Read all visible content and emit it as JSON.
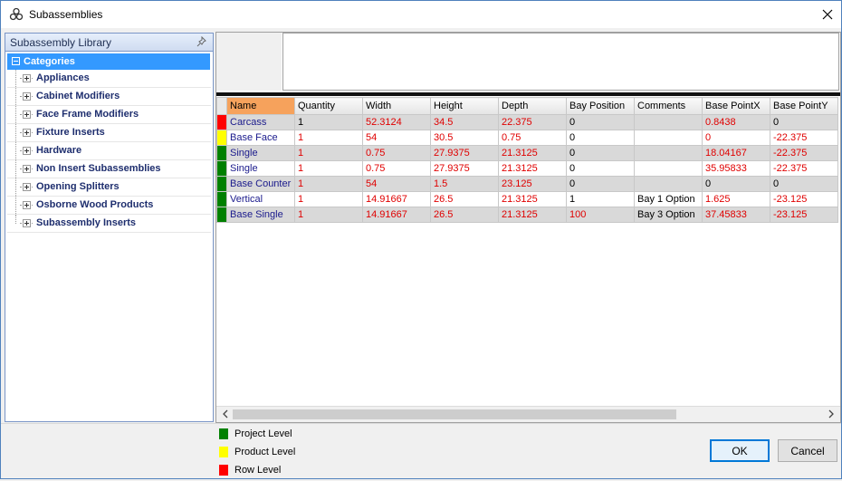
{
  "window": {
    "title": "Subassemblies"
  },
  "library": {
    "title": "Subassembly Library",
    "root": "Categories",
    "items": [
      "Appliances",
      "Cabinet Modifiers",
      "Face Frame Modifiers",
      "Fixture Inserts",
      "Hardware",
      "Non Insert Subassemblies",
      "Opening Splitters",
      "Osborne Wood Products",
      "Subassembly Inserts"
    ]
  },
  "grid": {
    "columns": [
      "Name",
      "Quantity",
      "Width",
      "Height",
      "Depth",
      "Bay Position",
      "Comments",
      "Base PointX",
      "Base PointY"
    ],
    "rows": [
      {
        "level": "row",
        "cells": [
          "Carcass",
          "1",
          "52.3124",
          "34.5",
          "22.375",
          "0",
          "",
          "0.8438",
          "0"
        ]
      },
      {
        "level": "product",
        "cells": [
          "Base Face",
          "1",
          "54",
          "30.5",
          "0.75",
          "0",
          "",
          "0",
          "-22.375"
        ]
      },
      {
        "level": "project",
        "cells": [
          "Single",
          "1",
          "0.75",
          "27.9375",
          "21.3125",
          "0",
          "",
          "18.04167",
          "-22.375"
        ]
      },
      {
        "level": "project",
        "cells": [
          "Single",
          "1",
          "0.75",
          "27.9375",
          "21.3125",
          "0",
          "",
          "35.95833",
          "-22.375"
        ]
      },
      {
        "level": "project",
        "cells": [
          "Base Counter",
          "1",
          "54",
          "1.5",
          "23.125",
          "0",
          "",
          "0",
          "0"
        ]
      },
      {
        "level": "project",
        "cells": [
          "Vertical",
          "1",
          "14.91667",
          "26.5",
          "21.3125",
          "1",
          "Bay 1 Option",
          "1.625",
          "-23.125"
        ]
      },
      {
        "level": "project",
        "cells": [
          "Base Single",
          "1",
          "14.91667",
          "26.5",
          "21.3125",
          "100",
          "Bay 3 Option",
          "37.45833",
          "-23.125"
        ]
      }
    ],
    "red_columns": [
      [
        false,
        false,
        true,
        true,
        true,
        false,
        false,
        true,
        false
      ],
      [
        false,
        true,
        true,
        true,
        true,
        false,
        false,
        true,
        true
      ],
      [
        false,
        true,
        true,
        true,
        true,
        false,
        false,
        true,
        true
      ],
      [
        false,
        true,
        true,
        true,
        true,
        false,
        false,
        true,
        true
      ],
      [
        false,
        true,
        true,
        true,
        true,
        false,
        false,
        false,
        false
      ],
      [
        false,
        true,
        true,
        true,
        true,
        false,
        false,
        true,
        true
      ],
      [
        false,
        true,
        true,
        true,
        true,
        true,
        false,
        true,
        true
      ]
    ]
  },
  "legend": [
    {
      "label": "Project Level",
      "color": "#008000"
    },
    {
      "label": "Product Level",
      "color": "#ffff00"
    },
    {
      "label": "Row Level",
      "color": "#ff0000"
    }
  ],
  "level_colors": {
    "project": "#008000",
    "product": "#ffff00",
    "row": "#ff0000"
  },
  "buttons": {
    "ok": "OK",
    "cancel": "Cancel"
  }
}
